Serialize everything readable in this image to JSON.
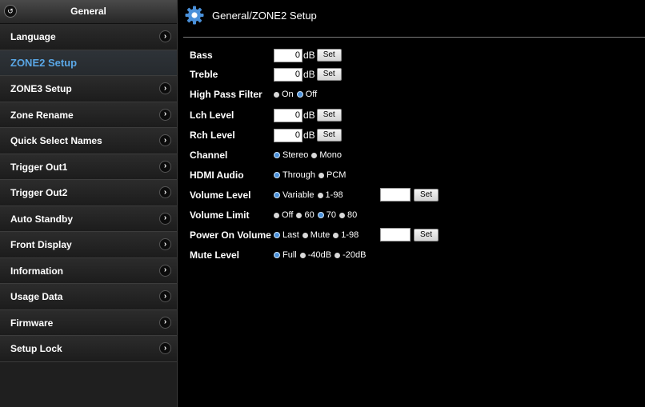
{
  "sidebar": {
    "title": "General",
    "items": [
      {
        "label": "Language",
        "active": false
      },
      {
        "label": "ZONE2 Setup",
        "active": true
      },
      {
        "label": "ZONE3 Setup",
        "active": false
      },
      {
        "label": "Zone Rename",
        "active": false
      },
      {
        "label": "Quick Select Names",
        "active": false
      },
      {
        "label": "Trigger Out1",
        "active": false
      },
      {
        "label": "Trigger Out2",
        "active": false
      },
      {
        "label": "Auto Standby",
        "active": false
      },
      {
        "label": "Front Display",
        "active": false
      },
      {
        "label": "Information",
        "active": false
      },
      {
        "label": "Usage Data",
        "active": false
      },
      {
        "label": "Firmware",
        "active": false
      },
      {
        "label": "Setup Lock",
        "active": false
      }
    ]
  },
  "main": {
    "title": "General/ZONE2 Setup",
    "set_label": "Set",
    "unit_db": "dB",
    "bass": {
      "label": "Bass",
      "value": "0"
    },
    "treble": {
      "label": "Treble",
      "value": "0"
    },
    "high_pass": {
      "label": "High Pass Filter",
      "options": [
        "On",
        "Off"
      ],
      "selected": 1
    },
    "lch": {
      "label": "Lch Level",
      "value": "0"
    },
    "rch": {
      "label": "Rch Level",
      "value": "0"
    },
    "channel": {
      "label": "Channel",
      "options": [
        "Stereo",
        "Mono"
      ],
      "selected": 0
    },
    "hdmi_audio": {
      "label": "HDMI Audio",
      "options": [
        "Through",
        "PCM"
      ],
      "selected": 0
    },
    "volume_level": {
      "label": "Volume Level",
      "options": [
        "Variable",
        "1-98"
      ],
      "selected": 0,
      "value": ""
    },
    "volume_limit": {
      "label": "Volume Limit",
      "options": [
        "Off",
        "60",
        "70",
        "80"
      ],
      "selected": 2
    },
    "power_on_volume": {
      "label": "Power On Volume",
      "options": [
        "Last",
        "Mute",
        "1-98"
      ],
      "selected": 0,
      "value": ""
    },
    "mute_level": {
      "label": "Mute Level",
      "options": [
        "Full",
        "-40dB",
        "-20dB"
      ],
      "selected": 0
    }
  },
  "colors": {
    "accent": "#5aa7e6",
    "radio_checked": "#4a90d9"
  }
}
